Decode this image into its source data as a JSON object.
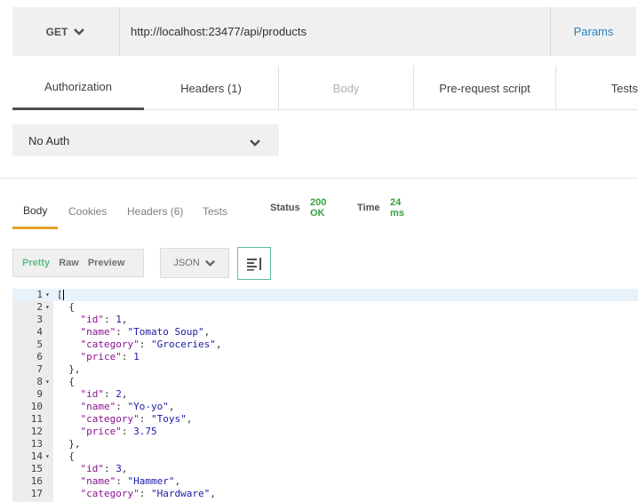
{
  "request": {
    "method": "GET",
    "url": "http://localhost:23477/api/products",
    "params_label": "Params"
  },
  "request_tabs": [
    {
      "label": "Authorization",
      "active": true,
      "disabled": false
    },
    {
      "label": "Headers (1)",
      "active": false,
      "disabled": false
    },
    {
      "label": "Body",
      "active": false,
      "disabled": true
    },
    {
      "label": "Pre-request script",
      "active": false,
      "disabled": false
    },
    {
      "label": "Tests",
      "active": false,
      "disabled": false
    }
  ],
  "auth": {
    "selected": "No Auth"
  },
  "response_tabs": [
    {
      "label": "Body",
      "active": true
    },
    {
      "label": "Cookies",
      "active": false
    },
    {
      "label": "Headers (6)",
      "active": false
    },
    {
      "label": "Tests",
      "active": false
    }
  ],
  "status": {
    "status_label": "Status",
    "status_value": "200 OK",
    "time_label": "Time",
    "time_value": "24 ms"
  },
  "format": {
    "pretty": "Pretty",
    "raw": "Raw",
    "preview": "Preview",
    "type": "JSON"
  },
  "colors": {
    "accent": "#e0a02a",
    "success": "#3aa042",
    "link": "#2a7fbf",
    "pretty_active": "#5bbf8a"
  },
  "code_lines": [
    {
      "n": "1",
      "fold": true,
      "text": "[",
      "hl": true
    },
    {
      "n": "2",
      "fold": true,
      "text": "  {"
    },
    {
      "n": "3",
      "fold": false,
      "key": "id",
      "val": "1",
      "type": "n",
      "comma": true
    },
    {
      "n": "4",
      "fold": false,
      "key": "name",
      "val": "\"Tomato Soup\"",
      "type": "s",
      "comma": true
    },
    {
      "n": "5",
      "fold": false,
      "key": "category",
      "val": "\"Groceries\"",
      "type": "s",
      "comma": true
    },
    {
      "n": "6",
      "fold": false,
      "key": "price",
      "val": "1",
      "type": "n",
      "comma": false
    },
    {
      "n": "7",
      "fold": false,
      "text": "  },"
    },
    {
      "n": "8",
      "fold": true,
      "text": "  {"
    },
    {
      "n": "9",
      "fold": false,
      "key": "id",
      "val": "2",
      "type": "n",
      "comma": true
    },
    {
      "n": "10",
      "fold": false,
      "key": "name",
      "val": "\"Yo-yo\"",
      "type": "s",
      "comma": true
    },
    {
      "n": "11",
      "fold": false,
      "key": "category",
      "val": "\"Toys\"",
      "type": "s",
      "comma": true
    },
    {
      "n": "12",
      "fold": false,
      "key": "price",
      "val": "3.75",
      "type": "n",
      "comma": false
    },
    {
      "n": "13",
      "fold": false,
      "text": "  },"
    },
    {
      "n": "14",
      "fold": true,
      "text": "  {"
    },
    {
      "n": "15",
      "fold": false,
      "key": "id",
      "val": "3",
      "type": "n",
      "comma": true
    },
    {
      "n": "16",
      "fold": false,
      "key": "name",
      "val": "\"Hammer\"",
      "type": "s",
      "comma": true
    },
    {
      "n": "17",
      "fold": false,
      "key": "category",
      "val": "\"Hardware\"",
      "type": "s",
      "comma": true
    }
  ]
}
